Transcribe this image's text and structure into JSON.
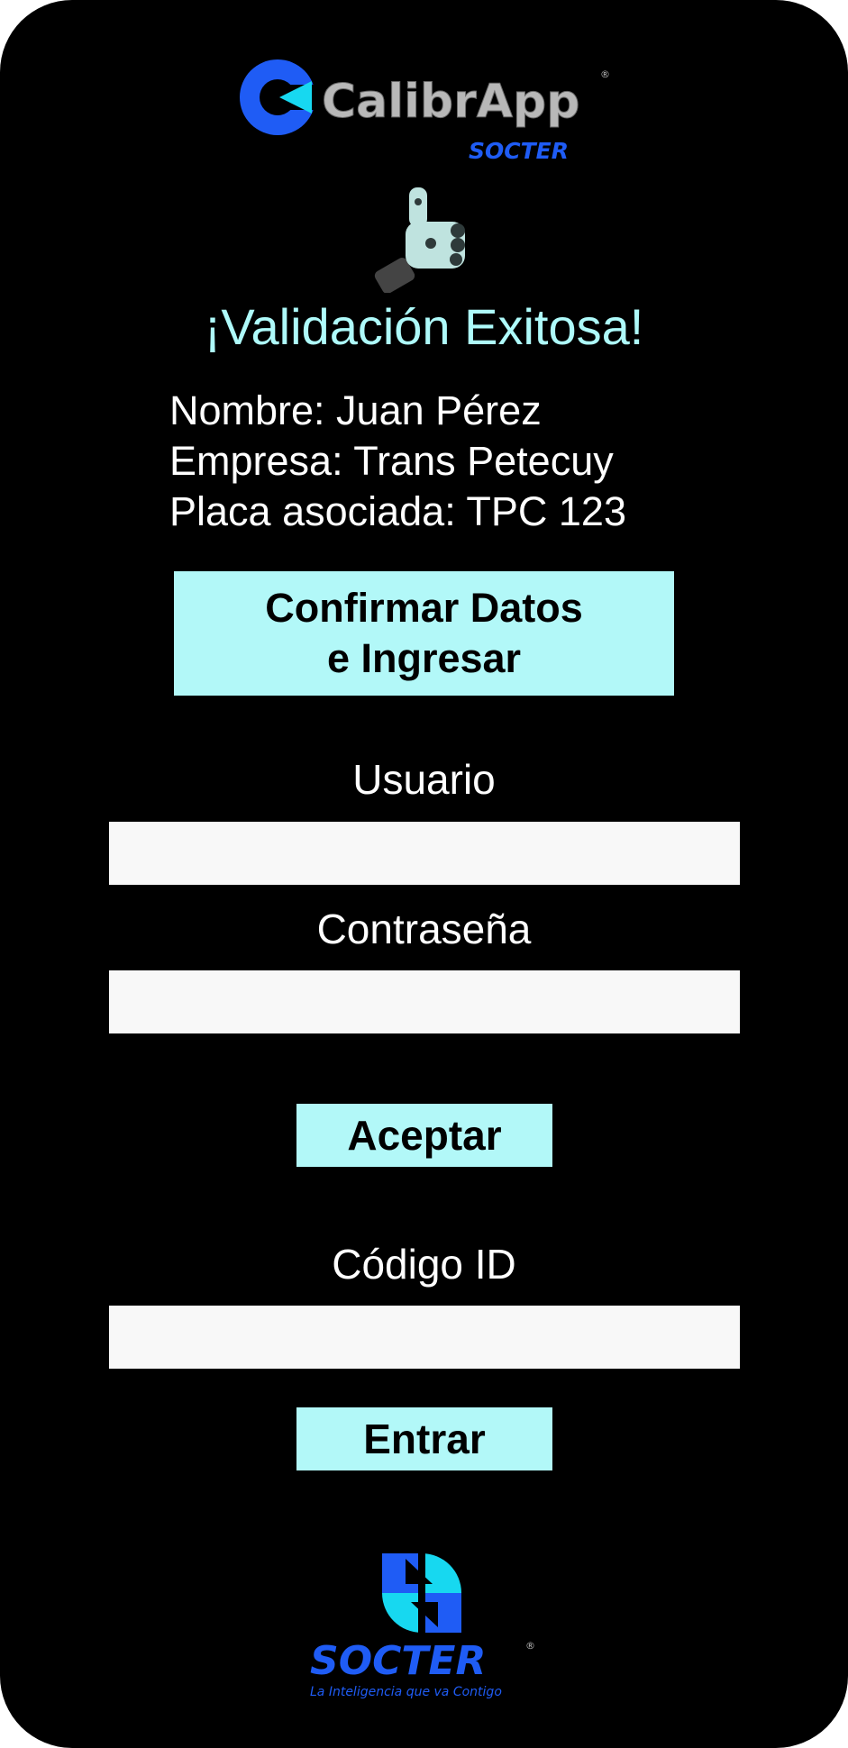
{
  "app": {
    "logo_text": "CalibrApp",
    "logo_sub": "SOCTER"
  },
  "validation": {
    "title": "¡Validación Exitosa!",
    "name_line": "Nombre: Juan Pérez",
    "company_line": "Empresa: Trans Petecuy",
    "plate_line": "Placa asociada: TPC 123"
  },
  "confirm_button": {
    "line1": "Confirmar Datos",
    "line2": "e Ingresar"
  },
  "login": {
    "user_label": "Usuario",
    "user_value": "",
    "password_label": "Contraseña",
    "password_value": "",
    "accept_label": "Aceptar"
  },
  "code": {
    "label": "Código ID",
    "value": "",
    "enter_label": "Entrar"
  },
  "footer": {
    "brand": "SOCTER",
    "tagline": "La Inteligencia que va Contigo"
  },
  "colors": {
    "accent": "#b2f8f8",
    "title": "#aefafa",
    "brand_blue": "#1f5cf5",
    "logo_cyan": "#17d8f0"
  }
}
